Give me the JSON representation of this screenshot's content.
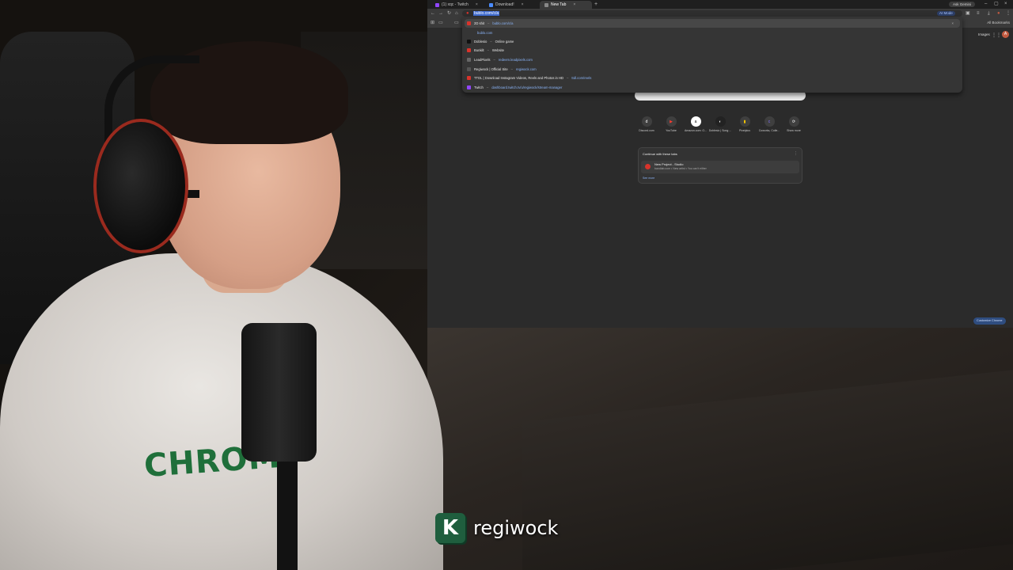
{
  "browser": {
    "tabs": [
      {
        "label": "(1) xqc - Twitch",
        "favicon_color": "#9146ff",
        "active": false
      },
      {
        "label": "Download!",
        "favicon_color": "#4a8cff",
        "active": false
      },
      {
        "label": "New Tab",
        "favicon_color": "#888888",
        "active": true
      }
    ],
    "new_tab_symbol": "+",
    "gemini_label": "Ask Gemini",
    "omnibox_text": "bublo.com/c/a",
    "ai_mode_label": "AI Mode",
    "bookmarks_all_label": "All Bookmarks"
  },
  "dropdown": {
    "items": [
      {
        "name": "2D shit",
        "sep": "–",
        "url": "bublo.com/c/a",
        "icon": "globe-icon",
        "selected": true
      },
      {
        "name": "",
        "sep": "",
        "url": "bublo.com",
        "icon": "search-icon",
        "selected": false
      },
      {
        "name": "Doblesio",
        "sep": "–",
        "url": "Online game",
        "icon": "game-icon",
        "selected": false
      },
      {
        "name": "Bunkilt",
        "sep": "–",
        "url": "Website",
        "icon": "globe-icon",
        "selected": false
      },
      {
        "name": "LeadPixels",
        "sep": "–",
        "url": "redeem.leadpixels.com",
        "icon": "globe-icon",
        "selected": false
      },
      {
        "name": "Regiwock | Official Site",
        "sep": "–",
        "url": "regiwock.com",
        "icon": "globe-icon",
        "selected": false
      },
      {
        "name": "TTDL | Download Instagram Videos, Reels and Photos in HD",
        "sep": "–",
        "url": "ttdl.com/reels",
        "icon": "globe-icon",
        "selected": false
      },
      {
        "name": "Twitch",
        "sep": "–",
        "url": "dashboard.twitch.tv/u/regiwock/stream-manager",
        "icon": "twitch-icon",
        "selected": false
      }
    ]
  },
  "newtab": {
    "images_label": "Images",
    "shortcuts": [
      {
        "label": "Discord.com",
        "glyph": "d"
      },
      {
        "label": "YouTube",
        "glyph": "▶"
      },
      {
        "label": "Amazon.com: O...",
        "glyph": "a"
      },
      {
        "label": "Doblesio | Song ...",
        "glyph": "◐"
      },
      {
        "label": "Pixelplus",
        "glyph": "▮"
      },
      {
        "label": "Coworks, Colle...",
        "glyph": "c"
      },
      {
        "label": "Show more",
        "glyph": "⟳"
      }
    ],
    "continue_title": "Continue with these tabs",
    "continue_item_name": "New Project - Studio",
    "continue_item_sub": "bandlab.com • New artist • You can't either",
    "continue_more": "See more",
    "customize_label": "Customize Chrome"
  },
  "overlay": {
    "logo_letter": "K",
    "name": "regiwock"
  },
  "scene": {
    "shirt_text": "CHROM"
  }
}
